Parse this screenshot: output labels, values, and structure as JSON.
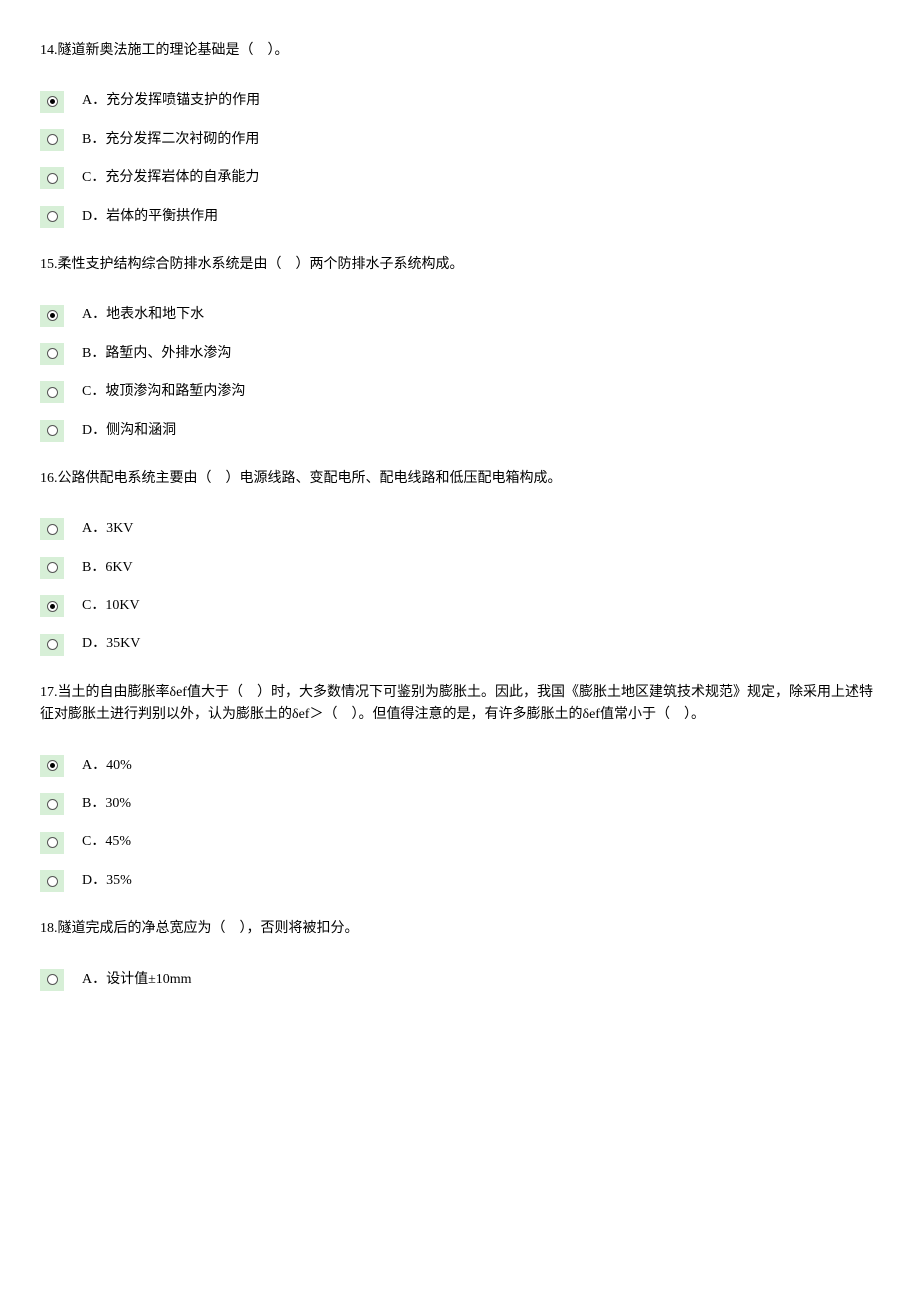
{
  "questions": [
    {
      "number": "14",
      "text": "隧道新奥法施工的理论基础是（　）。",
      "options": [
        {
          "label": "A．充分发挥喷锚支护的作用",
          "selected": true
        },
        {
          "label": "B．充分发挥二次衬砌的作用",
          "selected": false
        },
        {
          "label": "C．充分发挥岩体的自承能力",
          "selected": false
        },
        {
          "label": "D．岩体的平衡拱作用",
          "selected": false
        }
      ]
    },
    {
      "number": "15",
      "text": "柔性支护结构综合防排水系统是由（　）两个防排水子系统构成。",
      "options": [
        {
          "label": "A．地表水和地下水",
          "selected": true
        },
        {
          "label": "B．路堑内、外排水渗沟",
          "selected": false
        },
        {
          "label": "C．坡顶渗沟和路堑内渗沟",
          "selected": false
        },
        {
          "label": "D．侧沟和涵洞",
          "selected": false
        }
      ]
    },
    {
      "number": "16",
      "text": "公路供配电系统主要由（　）电源线路、变配电所、配电线路和低压配电箱构成。",
      "options": [
        {
          "label": "A．3KV",
          "selected": false
        },
        {
          "label": "B．6KV",
          "selected": false
        },
        {
          "label": "C．10KV",
          "selected": true
        },
        {
          "label": "D．35KV",
          "selected": false
        }
      ]
    },
    {
      "number": "17",
      "text": "当土的自由膨胀率δef值大于（　）时，大多数情况下可鉴别为膨胀土。因此，我国《膨胀土地区建筑技术规范》规定，除采用上述特征对膨胀土进行判别以外，认为膨胀土的δef＞（　）。但值得注意的是，有许多膨胀土的δef值常小于（　）。",
      "options": [
        {
          "label": "A．40%",
          "selected": true
        },
        {
          "label": "B．30%",
          "selected": false
        },
        {
          "label": "C．45%",
          "selected": false
        },
        {
          "label": "D．35%",
          "selected": false
        }
      ]
    },
    {
      "number": "18",
      "text": "隧道完成后的净总宽应为（　），否则将被扣分。",
      "options": [
        {
          "label": "A．设计值±10mm",
          "selected": false
        }
      ]
    }
  ]
}
